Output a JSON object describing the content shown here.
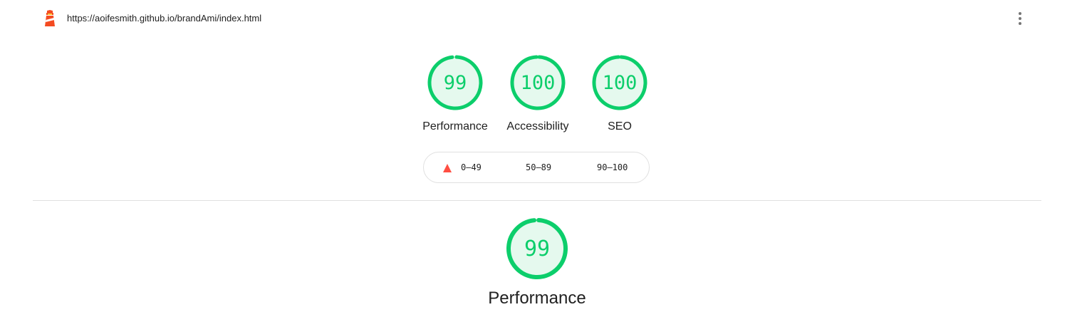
{
  "header": {
    "url": "https://aoifesmith.github.io/brandAmi/index.html",
    "logo_icon": "lighthouse-icon",
    "menu_icon": "kebab-menu-icon"
  },
  "gauges": [
    {
      "label": "Performance",
      "score": "99",
      "value": 0.99
    },
    {
      "label": "Accessibility",
      "score": "100",
      "value": 1.0
    },
    {
      "label": "SEO",
      "score": "100",
      "value": 1.0
    }
  ],
  "legend": {
    "fail": "0–49",
    "average": "50–89",
    "pass": "90–100"
  },
  "category": {
    "score": "99",
    "value": 0.99,
    "title": "Performance"
  },
  "colors": {
    "pass": "#0cce6b",
    "pass_bg": "#e5f9ee",
    "fail": "#ff4e42",
    "logo": "#f44b21"
  }
}
